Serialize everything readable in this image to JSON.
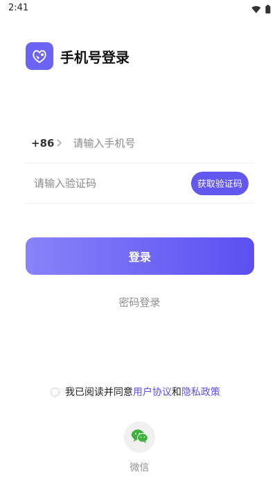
{
  "status_bar": {
    "time": "2:41",
    "icons": [
      "wifi-icon",
      "battery-icon"
    ]
  },
  "header": {
    "title": "手机号登录",
    "logo_icon": "app-logo-icon"
  },
  "phone": {
    "country_code": "+86",
    "placeholder": "请输入手机号"
  },
  "code": {
    "placeholder": "请输入验证码",
    "get_code_label": "获取验证码"
  },
  "login": {
    "label": "登录"
  },
  "password_login": {
    "label": "密码登录"
  },
  "agreement": {
    "prefix": "我已阅读并同意",
    "user_agreement": "用户协议",
    "and": "和",
    "privacy_policy": "隐私政策"
  },
  "wechat": {
    "label": "微信",
    "icon": "wechat-icon"
  },
  "colors": {
    "accent": "#6258f0",
    "gradient_start": "#8883f8",
    "gradient_end": "#5b4ff2",
    "wechat_green": "#3bb33b"
  }
}
